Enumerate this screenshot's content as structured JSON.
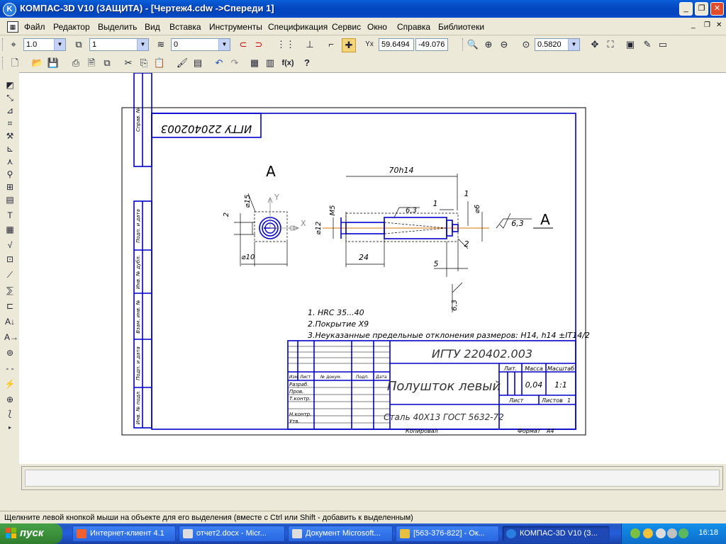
{
  "window": {
    "title": "КОМПАС-3D V10 (ЗАЩИТА) - [Чертеж4.cdw ->Спереди 1]",
    "app_icon_letter": "K"
  },
  "menu": [
    "Файл",
    "Редактор",
    "Выделить",
    "Вид",
    "Вставка",
    "Инструменты",
    "Спецификация",
    "Сервис",
    "Окно",
    "Справка",
    "Библиотеки"
  ],
  "toolbar": {
    "line_scale": "1.0",
    "layer_number": "1",
    "style_number": "0",
    "coord_x": "59.6494",
    "coord_y": "-49.076",
    "zoom": "0.5820",
    "fx_label": "f(x)"
  },
  "drawing": {
    "view_label": "А",
    "doc_code_rotated": "ИГТУ 220402003",
    "dims": {
      "d15": "⌀15",
      "d12": "⌀12",
      "d10": "⌀10",
      "d6": "⌀6",
      "m5": "M5",
      "len70": "70h14",
      "len24": "24",
      "two": "2",
      "one": "1",
      "five": "5",
      "rough": "6,3",
      "axis_x": "X",
      "axis_y": "Y"
    },
    "notes": [
      "1. HRC 35...40",
      "2.Покрытие Х9",
      "3.Неуказанные предельные отклонения размеров: Н14, h14 ±IT14/2"
    ],
    "side_stamp": [
      "Справ. №",
      "Подп. и дата",
      "Инв. № дубл.",
      "Взам. инв. №",
      "Подп. и дата",
      "Инв. № подл."
    ],
    "stamp": {
      "code": "ИГТУ 220402.003",
      "name": "Полушток левый",
      "material": "Сталь 40Х13  ГОСТ 5632-72",
      "col_lit": "Лит.",
      "col_mass": "Масса",
      "col_scale": "Масштаб",
      "mass": "0,04",
      "scale": "1:1",
      "sheet": "Лист",
      "sheets": "Листов",
      "sheets_count": "1",
      "row_headers": [
        "Изм.",
        "Лист",
        "№ докум.",
        "Подп.",
        "Дата"
      ],
      "roles": [
        "Разраб.",
        "Пров.",
        "Т.контр.",
        "Н.контр.",
        "Утв."
      ],
      "copied": "Копировал",
      "format": "Формат",
      "format_val": "А4"
    }
  },
  "status_text": "Щелкните левой кнопкой мыши на объекте для его выделения (вместе с Ctrl или Shift - добавить к выделенным)",
  "taskbar": {
    "start": "пуск",
    "tasks": [
      "Интернет-клиент 4.1",
      "отчет2.docx - Micr...",
      "Документ Microsoft...",
      "[563-376-822] - Ок...",
      "КОМПАС-3D V10 (З..."
    ],
    "clock": "16:18"
  }
}
